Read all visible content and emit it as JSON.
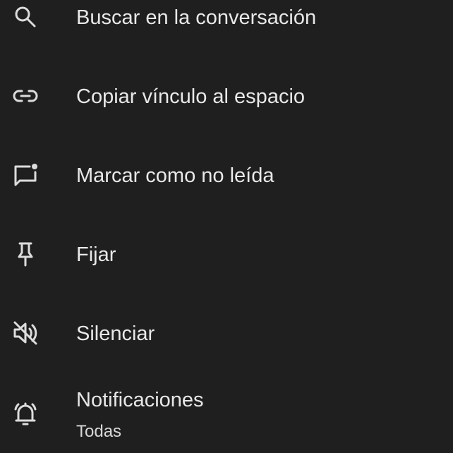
{
  "menu": {
    "items": [
      {
        "label": "Buscar en la conversación",
        "icon": "search-icon"
      },
      {
        "label": "Copiar vínculo al espacio",
        "icon": "link-icon"
      },
      {
        "label": "Marcar como no leída",
        "icon": "mark-unread-icon"
      },
      {
        "label": "Fijar",
        "icon": "pin-icon"
      },
      {
        "label": "Silenciar",
        "icon": "mute-icon"
      },
      {
        "label": "Notificaciones",
        "sublabel": "Todas",
        "icon": "notifications-bell-icon"
      }
    ]
  },
  "colors": {
    "background": "#1f1f20",
    "text": "#e8e8e8",
    "icon": "#dcdcdc"
  }
}
